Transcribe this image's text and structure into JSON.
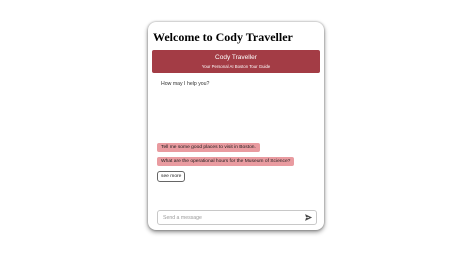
{
  "page": {
    "title": "Welcome to Cody Traveller"
  },
  "chat": {
    "header": {
      "name": "Cody Traveller",
      "tagline": "Your Personal AI Boston Tour Guide",
      "color": "#a33c45"
    },
    "bot_message": "How may I help you?",
    "suggestions": [
      "Tell me some good places to visit in Boston.",
      "What are the operational hours for the Museum of Science?"
    ],
    "see_more_label": "see more",
    "composer": {
      "placeholder": "Send a message",
      "value": "",
      "send_icon": "send-icon"
    }
  }
}
